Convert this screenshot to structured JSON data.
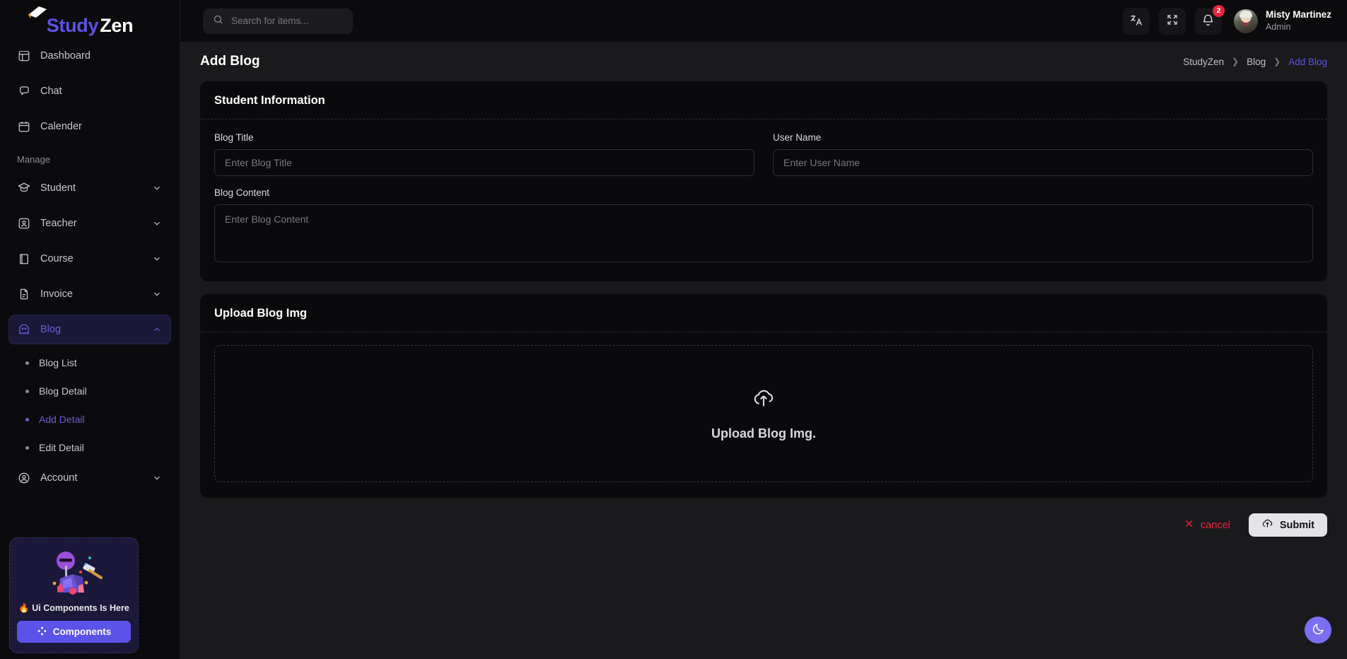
{
  "brand": {
    "name_part1": "Study",
    "name_part2": "Zen",
    "logo_icon": "graduation-cap-icon",
    "accent_color": "#5b52e8"
  },
  "sidebar": {
    "items": [
      {
        "label": "Dashboard",
        "icon": "dashboard-icon",
        "expandable": false
      },
      {
        "label": "Chat",
        "icon": "chat-icon",
        "expandable": false
      },
      {
        "label": "Calender",
        "icon": "calendar-icon",
        "expandable": false
      }
    ],
    "section_label": "Manage",
    "manage_items": [
      {
        "label": "Student",
        "icon": "student-cap-icon",
        "expandable": true
      },
      {
        "label": "Teacher",
        "icon": "teacher-icon",
        "expandable": true
      },
      {
        "label": "Course",
        "icon": "book-icon",
        "expandable": true
      },
      {
        "label": "Invoice",
        "icon": "file-icon",
        "expandable": true
      }
    ],
    "blog": {
      "label": "Blog",
      "icon": "ghost-icon",
      "expanded": true,
      "active": true
    },
    "blog_children": [
      {
        "label": "Blog List",
        "active": false
      },
      {
        "label": "Blog Detail",
        "active": false
      },
      {
        "label": "Add Detail",
        "active": true
      },
      {
        "label": "Edit Detail",
        "active": false
      }
    ],
    "account": {
      "label": "Account",
      "icon": "user-circle-icon",
      "expandable": true
    },
    "promo": {
      "headline": "🔥 Ui Components Is Here",
      "button_label": "Components",
      "button_icon": "diamond-grid-icon",
      "art": "miner-illustration"
    }
  },
  "topbar": {
    "search": {
      "placeholder": "Search for items...",
      "value": "",
      "icon": "search-icon"
    },
    "translate_icon": "translate-icon",
    "fullscreen_icon": "fullscreen-icon",
    "notification_icon": "bell-icon",
    "notification_count": "2",
    "user": {
      "name": "Misty Martinez",
      "role": "Admin",
      "avatar": "user-avatar"
    }
  },
  "page": {
    "title": "Add Blog",
    "breadcrumb": [
      {
        "label": "StudyZen",
        "current": false
      },
      {
        "label": "Blog",
        "current": false
      },
      {
        "label": "Add Blog",
        "current": true
      }
    ],
    "breadcrumb_separator": "❯"
  },
  "student_info_card": {
    "title": "Student Information",
    "fields": {
      "blog_title": {
        "label": "Blog Title",
        "placeholder": "Enter Blog Title",
        "value": ""
      },
      "user_name": {
        "label": "User Name",
        "placeholder": "Enter User Name",
        "value": ""
      },
      "blog_content": {
        "label": "Blog Content",
        "placeholder": "Enter Blog Content",
        "value": ""
      }
    }
  },
  "upload_card": {
    "title": "Upload Blog Img",
    "dropzone_text": "Upload Blog Img.",
    "dropzone_icon": "cloud-upload-icon"
  },
  "actions": {
    "cancel_label": "cancel",
    "cancel_icon": "close-x-icon",
    "cancel_color": "#e8263a",
    "submit_label": "Submit",
    "submit_icon": "cloud-upload-icon"
  },
  "theme_toggle": {
    "icon": "moon-icon",
    "color": "#7a6ff0"
  }
}
